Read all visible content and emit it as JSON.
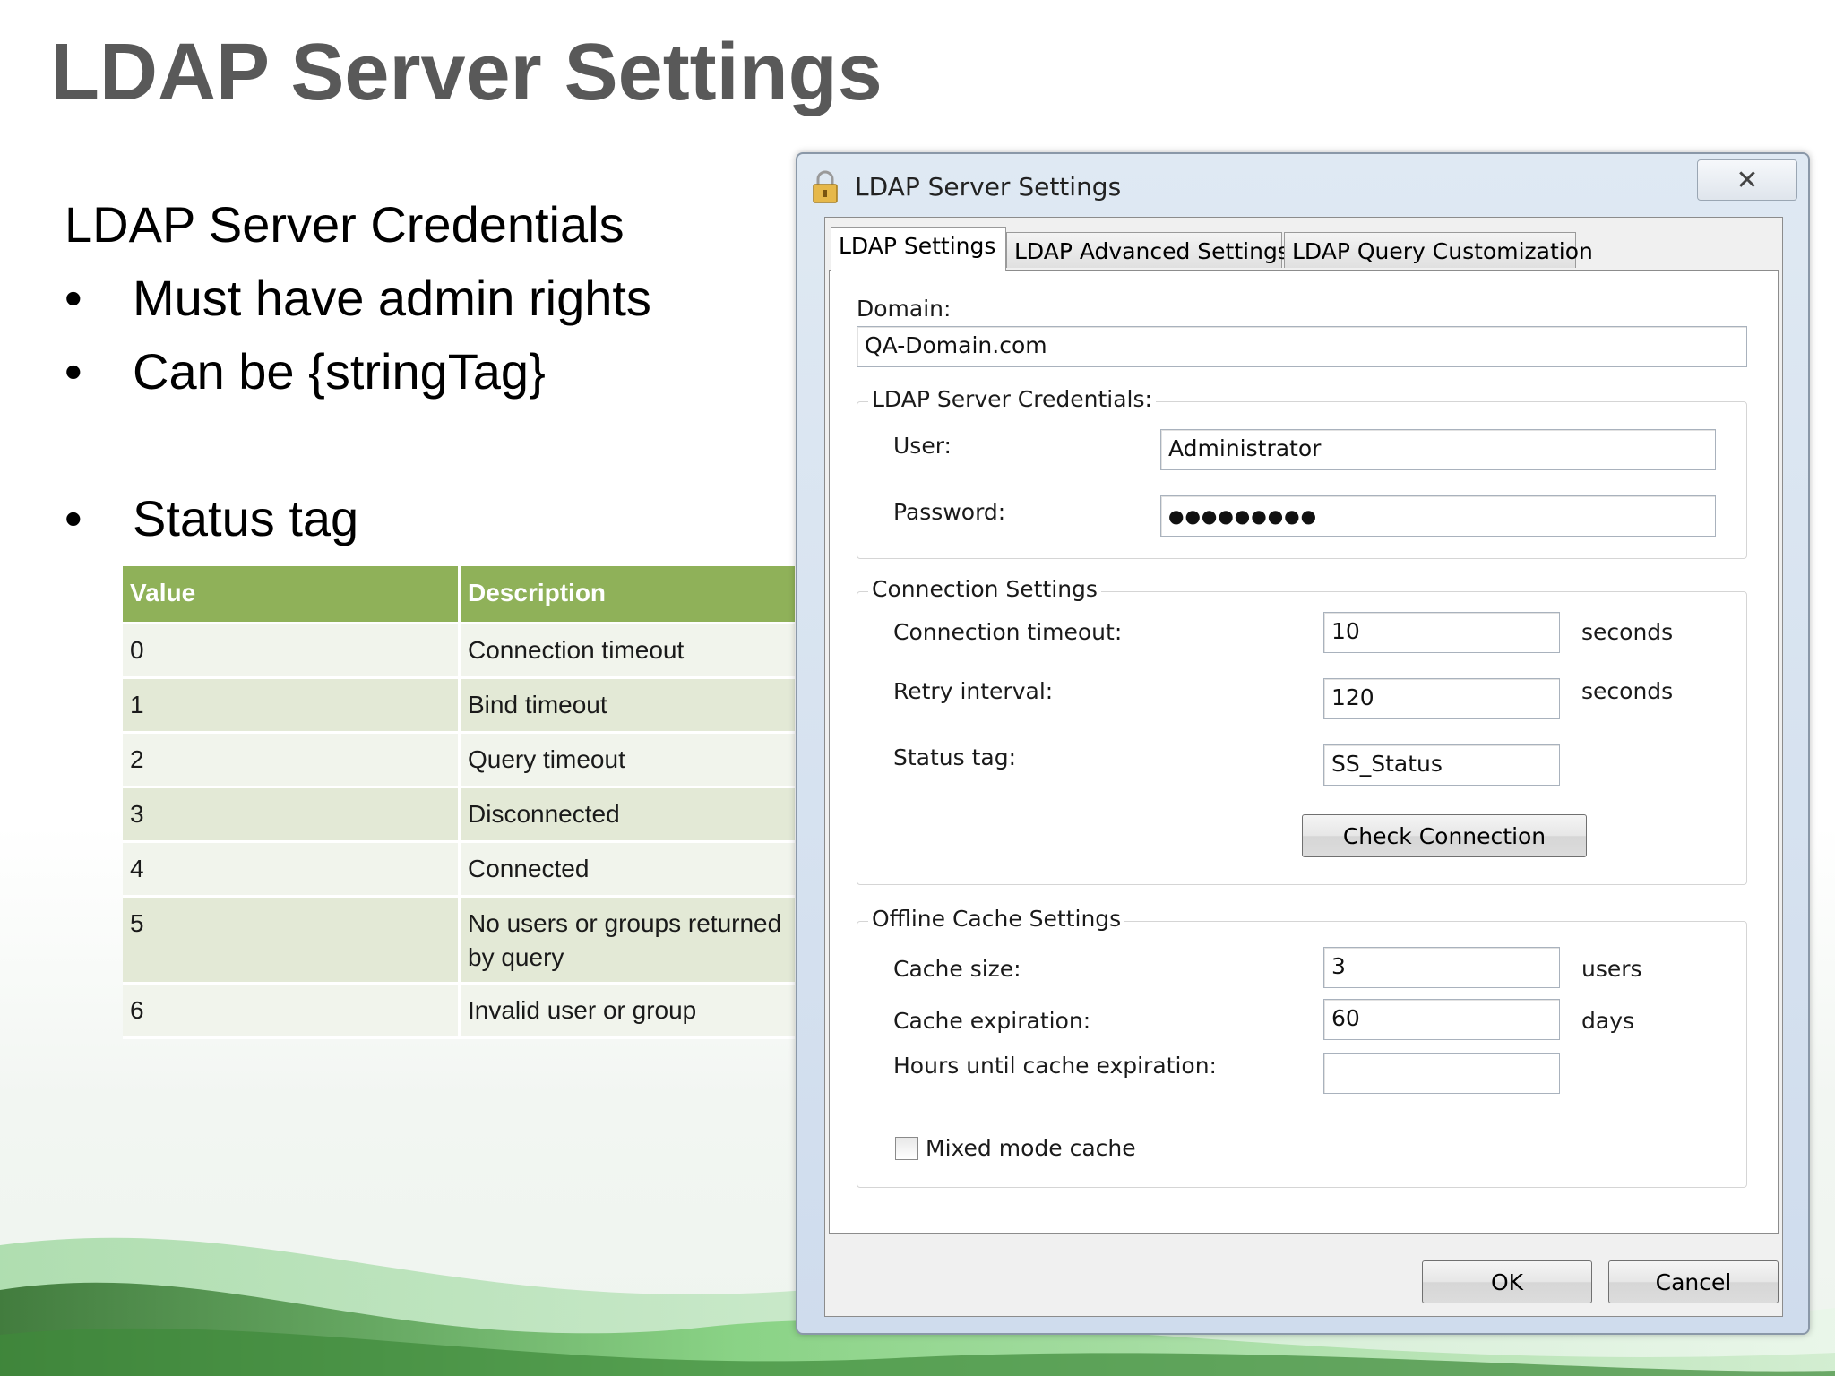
{
  "slide": {
    "title": "LDAP Server Settings",
    "subtitle": "LDAP Server Credentials",
    "bullets": [
      "Must have admin rights",
      "Can be {stringTag}",
      "Status tag"
    ],
    "bullet_glyph": "•"
  },
  "status_table": {
    "headers": [
      "Value",
      "Description"
    ],
    "rows": [
      [
        "0",
        "Connection timeout"
      ],
      [
        "1",
        "Bind timeout"
      ],
      [
        "2",
        "Query timeout"
      ],
      [
        "3",
        "Disconnected"
      ],
      [
        "4",
        "Connected"
      ],
      [
        "5",
        "No users or groups returned by query"
      ],
      [
        "6",
        "Invalid user or group"
      ]
    ],
    "colors": {
      "header": "#8fb159",
      "row_a": "#e3e9d6",
      "row_b": "#f1f4ec"
    }
  },
  "dialog": {
    "title": "LDAP Server Settings",
    "icon": "lock-icon",
    "close_glyph": "✕",
    "tabs": [
      "LDAP Settings",
      "LDAP Advanced Settings",
      "LDAP Query Customization"
    ],
    "active_tab": 0,
    "domain": {
      "label": "Domain:",
      "value": "QA-Domain.com"
    },
    "credentials": {
      "title": "LDAP Server Credentials:",
      "user_label": "User:",
      "user_value": "Administrator",
      "password_label": "Password:",
      "password_value": "●●●●●●●●●"
    },
    "connection": {
      "title": "Connection Settings",
      "timeout_label": "Connection timeout:",
      "timeout_value": "10",
      "timeout_unit": "seconds",
      "retry_label": "Retry interval:",
      "retry_value": "120",
      "retry_unit": "seconds",
      "status_label": "Status tag:",
      "status_value": "SS_Status",
      "check_button": "Check Connection"
    },
    "cache": {
      "title": "Offline Cache Settings",
      "size_label": "Cache size:",
      "size_value": "3",
      "size_unit": "users",
      "expiration_label": "Cache expiration:",
      "expiration_value": "60",
      "expiration_unit": "days",
      "hours_label": "Hours until cache expiration:",
      "hours_value": "",
      "mixed_label": "Mixed mode cache",
      "mixed_checked": false
    },
    "ok_button": "OK",
    "cancel_button": "Cancel"
  }
}
